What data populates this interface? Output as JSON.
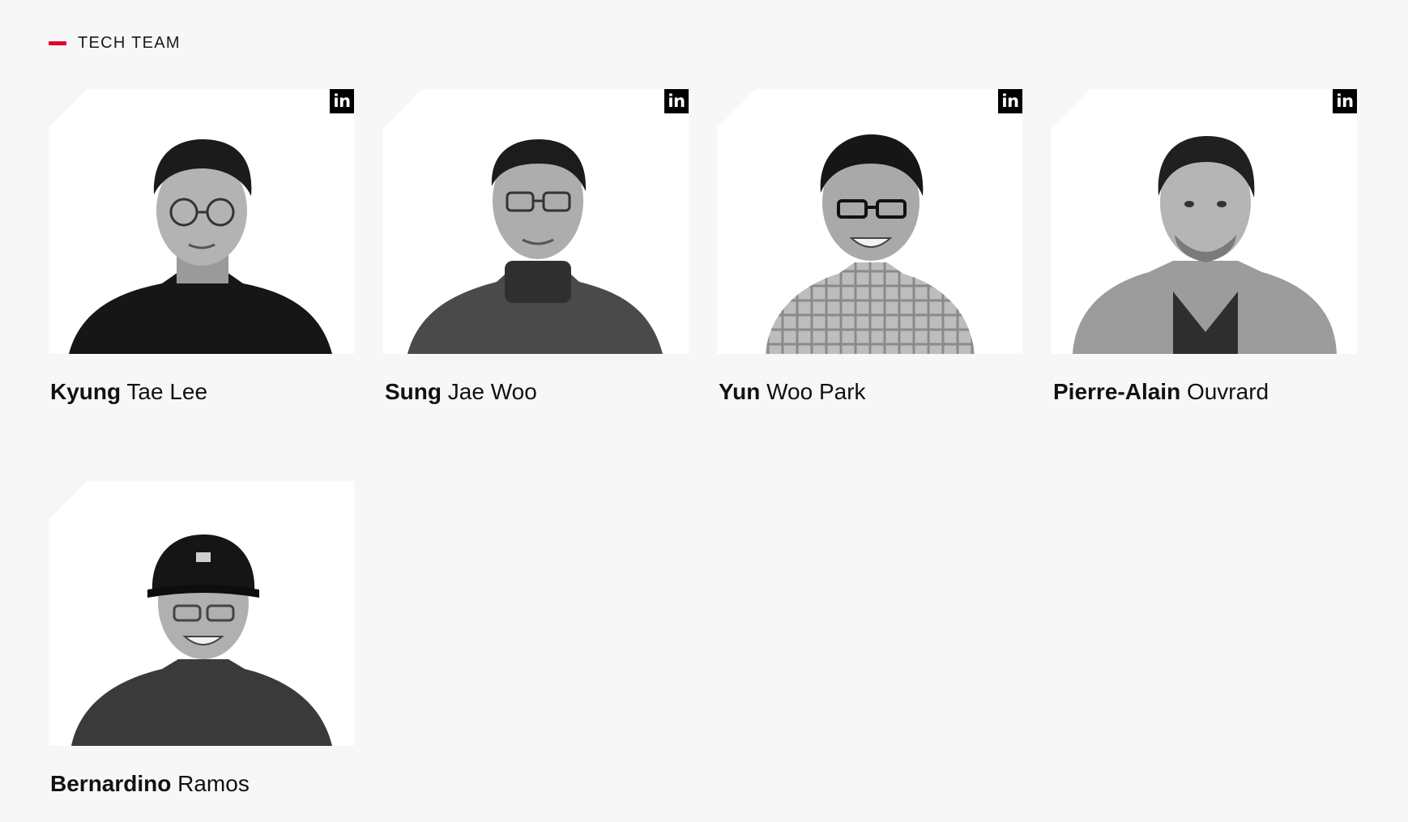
{
  "section": {
    "label": "TECH TEAM",
    "accent_color": "#e4002b"
  },
  "members": [
    {
      "first": "Kyung",
      "last": "Tae Lee",
      "social_icon": "linkedin-icon",
      "social_label": "in"
    },
    {
      "first": "Sung",
      "last": "Jae Woo",
      "social_icon": "linkedin-icon",
      "social_label": "in"
    },
    {
      "first": "Yun",
      "last": "Woo Park",
      "social_icon": "linkedin-icon",
      "social_label": "in"
    },
    {
      "first": "Pierre-Alain",
      "last": "Ouvrard",
      "social_icon": "linkedin-icon",
      "social_label": "in"
    },
    {
      "first": "Bernardino",
      "last": "Ramos",
      "social_icon": null
    }
  ]
}
